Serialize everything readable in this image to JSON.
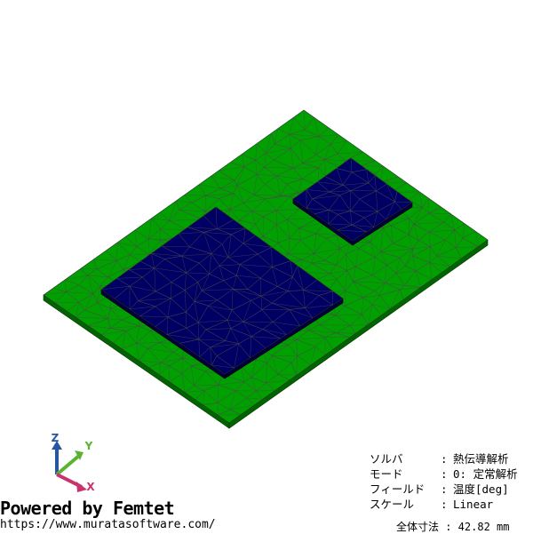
{
  "info": {
    "rows": [
      {
        "key": "ソルバ",
        "sep": ":",
        "value": "熱伝導解析"
      },
      {
        "key": "モード",
        "sep": ":",
        "value": "0: 定常解析"
      },
      {
        "key": "フィールド",
        "sep": ":",
        "value": "温度[deg]"
      },
      {
        "key": "スケール",
        "sep": ":",
        "value": "Linear"
      }
    ]
  },
  "branding": {
    "powered": "Powered by Femtet",
    "url": "https://www.muratasoftware.com/"
  },
  "dimension": {
    "text": "全体寸法 : 42.82 mm"
  },
  "axes": {
    "x_label": "X",
    "y_label": "Y",
    "z_label": "Z",
    "x_color": "#c8326e",
    "y_color": "#5ab432",
    "z_color": "#2855a0"
  },
  "model": {
    "board_color": "#00a000",
    "board_side_color": "#006400",
    "chip_color": "#000064",
    "mesh_color": "#4a4a4a"
  }
}
